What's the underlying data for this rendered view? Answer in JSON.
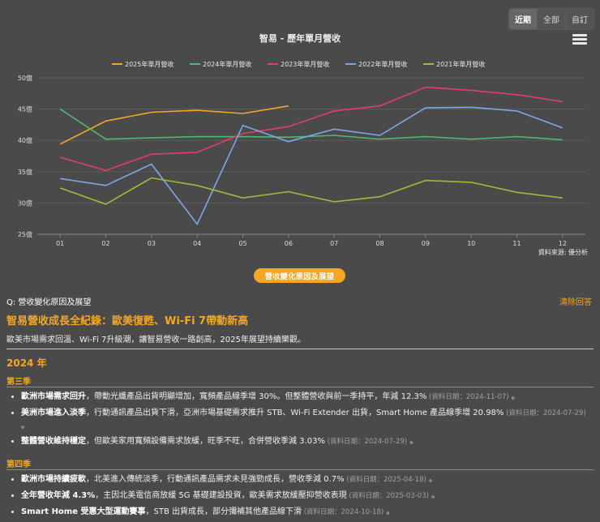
{
  "range_buttons": [
    "近期",
    "全部",
    "自訂"
  ],
  "chart_data": {
    "type": "line",
    "title": "智易 - 歷年單月營收",
    "categories": [
      "01",
      "02",
      "03",
      "04",
      "05",
      "06",
      "07",
      "08",
      "09",
      "10",
      "11",
      "12"
    ],
    "y_ticks": [
      "25億",
      "30億",
      "35億",
      "40億",
      "45億",
      "50億"
    ],
    "ylim": [
      25,
      50
    ],
    "legend_position": "top-center",
    "series": [
      {
        "name": "2025年單月營收",
        "color": "#f5a623",
        "values": [
          39.4,
          43.1,
          44.5,
          44.8,
          44.3,
          45.5,
          null,
          null,
          null,
          null,
          null,
          null
        ]
      },
      {
        "name": "2024年單月營收",
        "color": "#4fb873",
        "values": [
          45.0,
          40.2,
          40.4,
          40.6,
          40.6,
          40.5,
          40.8,
          40.2,
          40.6,
          40.2,
          40.6,
          40.1
        ]
      },
      {
        "name": "2023年單月營收",
        "color": "#e23d6a",
        "values": [
          37.3,
          35.2,
          37.8,
          38.1,
          41.1,
          42.2,
          44.7,
          45.5,
          48.5,
          48.0,
          47.3,
          46.2
        ]
      },
      {
        "name": "2022年單月營收",
        "color": "#7ea7e8",
        "values": [
          33.9,
          32.8,
          36.2,
          26.6,
          42.4,
          39.8,
          41.8,
          40.8,
          45.2,
          45.3,
          44.7,
          42.0
        ]
      },
      {
        "name": "2021年單月營收",
        "color": "#a6b73a",
        "values": [
          32.4,
          29.8,
          34.0,
          32.8,
          30.8,
          31.8,
          30.2,
          31.0,
          33.6,
          33.3,
          31.7,
          30.8
        ]
      }
    ],
    "grid": true
  },
  "source": "資料來源: 優分析",
  "reason_button": "營收變化原因及展望",
  "question": "Q: 營收變化原因及展望",
  "clear": "清除回答",
  "headline": "智易營收成長全紀錄：歐美復甦、Wi-Fi 7帶動新高",
  "intro": "歐美市場需求回溫、Wi-Fi 7升級潮，讓智易營收一路創高，2025年展望持續樂觀。",
  "year": "2024 年",
  "q3": {
    "label": "第三季",
    "items": [
      {
        "head": "歐洲市場需求回升",
        "body": "，帶動光纖產品出貨明顯增加，寬頻產品線季增 30%。但整體營收與前一季持平，年減 12.3%",
        "date": "(資料日期：2024-11-07)",
        "tail": " 。"
      },
      {
        "head": "美洲市場進入淡季",
        "body": "，行動通訊產品出貨下滑，亞洲市場基礎需求推升 STB、Wi-Fi Extender 出貨，Smart Home 產品線季增 20.98%",
        "date": "(資料日期：2024-07-29)",
        "tail": " 。"
      },
      {
        "head": "整體營收維持穩定",
        "body": "，但歐美家用寬頻設備需求放緩，旺季不旺，合併營收季減 3.03%",
        "date": "(資料日期：2024-07-29)",
        "tail": " 。"
      }
    ]
  },
  "q4": {
    "label": "第四季",
    "items": [
      {
        "head": "歐洲市場持續疲軟",
        "body": "，北美進入傳統淡季，行動通訊產品需求未見強勁成長，營收季減 0.7%",
        "date": "(資料日期：2025-04-18)",
        "tail": " 。"
      },
      {
        "head": "全年營收年減 4.3%",
        "body": "，主因北美電信商放緩 5G 基礎建設投資，歐美需求放緩壓抑營收表現",
        "date": "(資料日期：2025-03-03)",
        "tail": " 。"
      },
      {
        "head": "Smart Home 受惠大型運動賽事",
        "body": "，STB 出貨成長，部分彌補其他產品線下滑",
        "date": "(資料日期：2024-10-18)",
        "tail": " 。"
      }
    ]
  }
}
